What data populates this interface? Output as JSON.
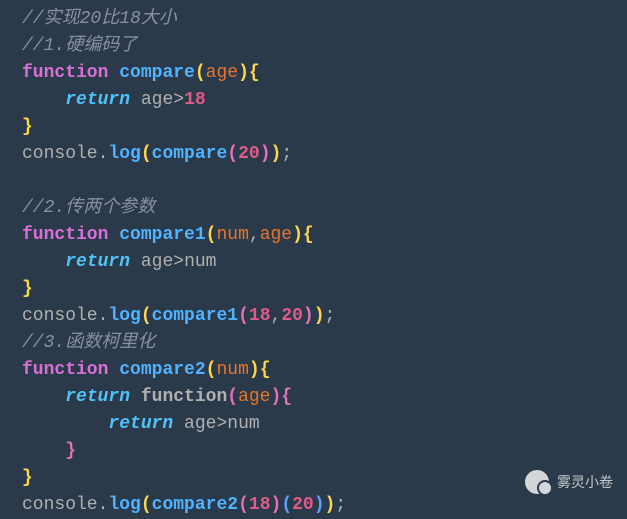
{
  "code": {
    "c1": "//实现20比18大小",
    "c2": "//1.硬编码了",
    "kw_function": "function",
    "kw_return": "return",
    "fn_compare": "compare",
    "fn_compare1": "compare1",
    "fn_compare2": "compare2",
    "fn_inner": "function",
    "param_age": "age",
    "param_num": "num",
    "num18": "18",
    "num20": "20",
    "c3": "//2.传两个参数",
    "c4": "//3.函数柯里化",
    "obj_console": "console",
    "method_log": "log",
    "op_gt": ">",
    "op_comma": ",",
    "op_dot": ".",
    "op_semi": ";",
    "br_open": "{",
    "br_close": "}",
    "pr_open": "(",
    "pr_close": ")"
  },
  "watermark": {
    "text": "雾灵小卷"
  }
}
